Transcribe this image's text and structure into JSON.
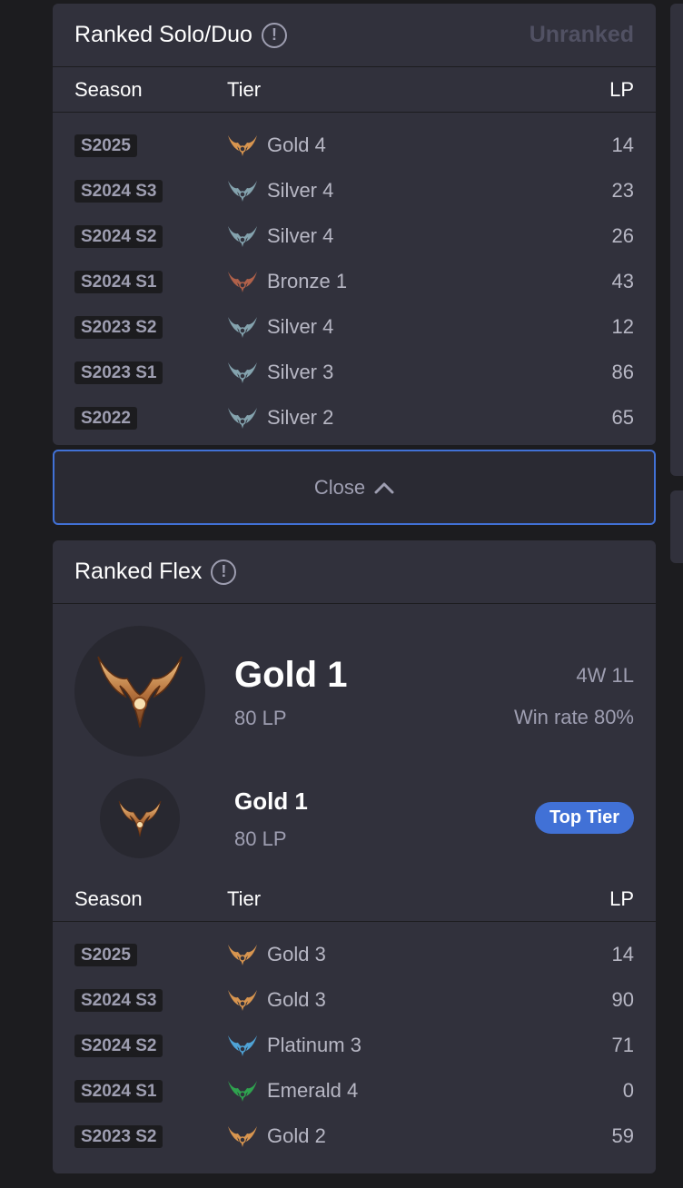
{
  "solo": {
    "title": "Ranked Solo/Duo",
    "info": "!",
    "status": "Unranked",
    "headers": {
      "season": "Season",
      "tier": "Tier",
      "lp": "LP"
    },
    "rows": [
      {
        "season": "S2025",
        "tier": "Gold 4",
        "lp": "14",
        "color": "#d8954f"
      },
      {
        "season": "S2024 S3",
        "tier": "Silver 4",
        "lp": "23",
        "color": "#84a3ae"
      },
      {
        "season": "S2024 S2",
        "tier": "Silver 4",
        "lp": "26",
        "color": "#84a3ae"
      },
      {
        "season": "S2024 S1",
        "tier": "Bronze 1",
        "lp": "43",
        "color": "#b0614a"
      },
      {
        "season": "S2023 S2",
        "tier": "Silver 4",
        "lp": "12",
        "color": "#84a3ae"
      },
      {
        "season": "S2023 S1",
        "tier": "Silver 3",
        "lp": "86",
        "color": "#84a3ae"
      },
      {
        "season": "S2022",
        "tier": "Silver 2",
        "lp": "65",
        "color": "#84a3ae"
      }
    ]
  },
  "close_button": {
    "label": "Close",
    "icon": "chevron-up-icon"
  },
  "flex": {
    "title": "Ranked Flex",
    "info": "!",
    "current": {
      "tier": "Gold 1",
      "lp": "80 LP",
      "record": "4W 1L",
      "win_rate": "Win rate 80%"
    },
    "peak": {
      "tier": "Gold 1",
      "lp": "80 LP",
      "badge": "Top Tier"
    },
    "headers": {
      "season": "Season",
      "tier": "Tier",
      "lp": "LP"
    },
    "rows": [
      {
        "season": "S2025",
        "tier": "Gold 3",
        "lp": "14",
        "color": "#d8954f"
      },
      {
        "season": "S2024 S3",
        "tier": "Gold 3",
        "lp": "90",
        "color": "#d8954f"
      },
      {
        "season": "S2024 S2",
        "tier": "Platinum 3",
        "lp": "71",
        "color": "#4fa3d6"
      },
      {
        "season": "S2024 S1",
        "tier": "Emerald 4",
        "lp": "0",
        "color": "#2fa34f"
      },
      {
        "season": "S2023 S2",
        "tier": "Gold 2",
        "lp": "59",
        "color": "#d8954f"
      }
    ]
  },
  "colors": {
    "accent": "#4171d6",
    "card": "#31313c",
    "background": "#1c1c1f"
  }
}
